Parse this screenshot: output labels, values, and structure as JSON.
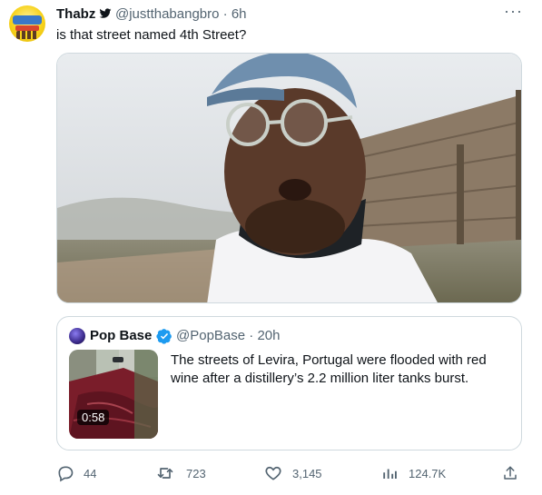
{
  "tweet": {
    "author_name": "Thabz",
    "author_handle": "@justthabangbro",
    "timestamp": "· 6h",
    "text": "is that street named 4th Street?",
    "more_label": "···"
  },
  "quoted_tweet": {
    "author_name": "Pop Base",
    "author_handle": "@PopBase",
    "timestamp": "· 20h",
    "text": "The streets of Levira, Portugal were flooded with red wine after a distillery’s 2.2 million liter tanks burst.",
    "video_duration": "0:58"
  },
  "actions": {
    "replies": "44",
    "retweets": "723",
    "likes": "3,145",
    "views": "124.7K"
  },
  "icons": {
    "author_badge": "bird-icon",
    "quoted_badge": "verified-check-icon",
    "reply": "reply-icon",
    "retweet": "retweet-icon",
    "like": "heart-icon",
    "views": "views-chart-icon",
    "share": "share-icon"
  },
  "colors": {
    "text": "#0f1419",
    "secondary": "#536471",
    "border": "#cfd9de",
    "verified": "#1d9bf0"
  }
}
